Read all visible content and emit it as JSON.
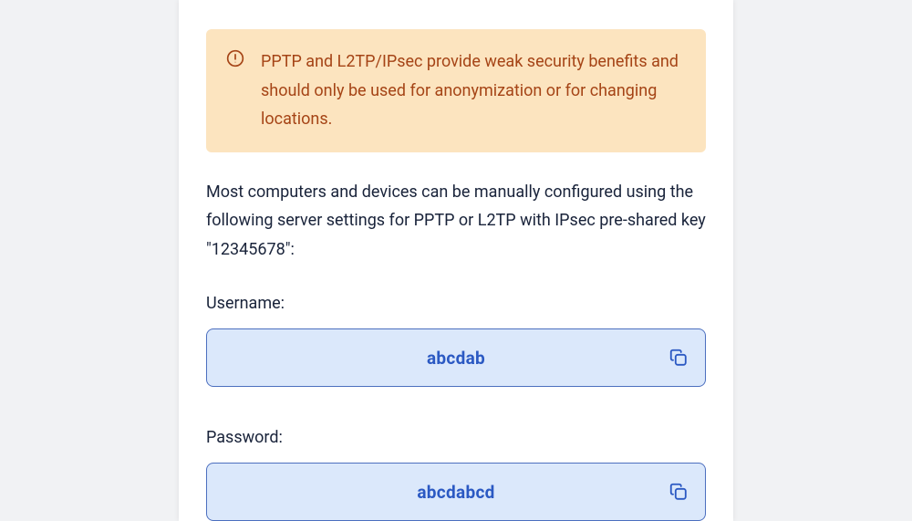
{
  "alert": {
    "text": "PPTP and L2TP/IPsec provide weak security benefits and should only be used for anonymization or for changing locations."
  },
  "description": "Most computers and devices can be manually configured using the following server settings for PPTP or L2TP with IPsec pre-shared key \"12345678\":",
  "credentials": {
    "username_label": "Username:",
    "username_value": "abcdab",
    "password_label": "Password:",
    "password_value": "abcdabcd"
  }
}
